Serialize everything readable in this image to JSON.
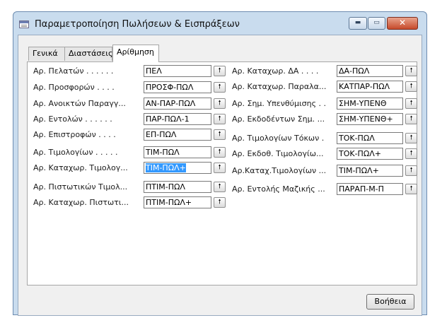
{
  "window": {
    "title": "Παραμετροποίηση Πωλήσεων & Εισπράξεων"
  },
  "title_buttons": {
    "minimize": "▬",
    "maximize": "▭",
    "close": "✕"
  },
  "tabs": [
    {
      "label": "Γενικά"
    },
    {
      "label": "Διαστάσεις"
    },
    {
      "label": "Αρίθμηση",
      "active": true
    }
  ],
  "lookup_glyph": "🠕",
  "left_fields": [
    {
      "label": "Αρ. Πελατών . . . . . .",
      "value": "ΠΕΛ"
    },
    {
      "label": "Αρ. Προσφορών . . . .",
      "value": "ΠΡΟΣΦ-ΠΩΛ"
    },
    {
      "label": "Αρ. Ανοικτών Παραγγ...",
      "value": "ΑΝ-ΠΑΡ-ΠΩΛ"
    },
    {
      "label": "Αρ. Εντολών . . . . . .",
      "value": "ΠΑΡ-ΠΩΛ-1"
    },
    {
      "label": "Αρ. Επιστροφών . . . .",
      "value": "ΕΠ-ΠΩΛ"
    },
    {
      "label": "Αρ. Τιμολογίων . . . . .",
      "value": "ΤΙΜ-ΠΩΛ"
    },
    {
      "label": "Αρ. Καταχωρ. Τιμολογ...",
      "value": "ΤΙΜ-ΠΩΛ+",
      "selected": true
    },
    {
      "label": "Αρ. Πιστωτικών Τιμολ...",
      "value": "ΠΤΙΜ-ΠΩΛ"
    },
    {
      "label": "Αρ. Καταχωρ. Πιστωτι...",
      "value": "ΠΤΙΜ-ΠΩΛ+"
    }
  ],
  "right_fields": [
    {
      "label": "Αρ. Καταχωρ. ΔΑ . . . .",
      "value": "ΔΑ-ΠΩΛ"
    },
    {
      "label": "Αρ. Καταχωρ. Παραλα...",
      "value": "ΚΑΤΠΑΡ-ΠΩΛ"
    },
    {
      "label": "Αρ. Σημ. Υπενθύμισης . .",
      "value": "ΣΗΜ-ΥΠΕΝΘ"
    },
    {
      "label": "Αρ. Εκδοδέντων Σημ. ...",
      "value": "ΣΗΜ-ΥΠΕΝΘ+"
    },
    {
      "label": "Αρ. Τιμολογίων Τόκων .",
      "value": "ΤΟΚ-ΠΩΛ"
    },
    {
      "label": "Αρ. Εκδοθ. Τιμολογίω...",
      "value": "ΤΟΚ-ΠΩΛ+"
    },
    {
      "label": "Αρ.Καταχ.Τιμολογίων ...",
      "value": "ΤΙΜ-ΠΩΛ+"
    },
    {
      "label": "Αρ. Εντολής Μαζικής ...",
      "value": "ΠΑΡΑΠ-Μ-Π"
    }
  ],
  "help_button": "Βοήθεια"
}
